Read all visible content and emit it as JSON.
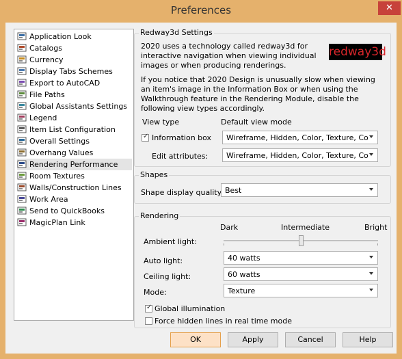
{
  "window": {
    "title": "Preferences",
    "close_glyph": "✕",
    "accent": "#e5b16c"
  },
  "tree": {
    "items": [
      {
        "label": "Application Look",
        "icon": "application-look-icon"
      },
      {
        "label": "Catalogs",
        "icon": "catalogs-icon"
      },
      {
        "label": "Currency",
        "icon": "currency-icon"
      },
      {
        "label": "Display Tabs Schemes",
        "icon": "display-tabs-icon"
      },
      {
        "label": "Export to AutoCAD",
        "icon": "export-autocad-icon"
      },
      {
        "label": "File Paths",
        "icon": "file-paths-icon"
      },
      {
        "label": "Global Assistants Settings",
        "icon": "global-assistants-icon"
      },
      {
        "label": "Legend",
        "icon": "legend-icon"
      },
      {
        "label": "Item List Configuration",
        "icon": "item-list-icon"
      },
      {
        "label": "Overall Settings",
        "icon": "overall-settings-icon"
      },
      {
        "label": "Overhang Values",
        "icon": "overhang-values-icon"
      },
      {
        "label": "Rendering Performance",
        "icon": "rendering-performance-icon",
        "selected": true
      },
      {
        "label": "Room Textures",
        "icon": "room-textures-icon"
      },
      {
        "label": "Walls/Construction Lines",
        "icon": "walls-icon"
      },
      {
        "label": "Work Area",
        "icon": "work-area-icon"
      },
      {
        "label": "Send to QuickBooks",
        "icon": "quickbooks-icon"
      },
      {
        "label": "MagicPlan Link",
        "icon": "magicplan-icon"
      }
    ]
  },
  "redway": {
    "legend": "Redway3d Settings",
    "intro": "2020 uses a technology called redway3d for interactive navigation when viewing individual images or when producing renderings.",
    "logo_red": "red",
    "logo_rest": "way3d",
    "notice": "If you notice that 2020 Design is unusually slow when viewing an item's image in the Information Box or when using the Walkthrough feature in the Rendering Module, disable the following view types accordingly.",
    "col_view_type": "View type",
    "col_default_mode": "Default view mode",
    "info_box_label": "Information box",
    "info_box_checked": true,
    "info_box_value": "Wireframe, Hidden, Color, Texture, Color ...",
    "edit_attr_label": "Edit attributes:",
    "edit_attr_value": "Wireframe, Hidden, Color, Texture, Color ..."
  },
  "shapes": {
    "legend": "Shapes",
    "quality_label": "Shape display quality:",
    "quality_value": "Best"
  },
  "rendering": {
    "legend": "Rendering",
    "slider_low": "Dark",
    "slider_mid": "Intermediate",
    "slider_high": "Bright",
    "ambient_label": "Ambient light:",
    "ambient_level": 0.5,
    "auto_label": "Auto light:",
    "auto_value": "40 watts",
    "ceiling_label": "Ceiling light:",
    "ceiling_value": "60 watts",
    "mode_label": "Mode:",
    "mode_value": "Texture",
    "global_illum_label": "Global illumination",
    "global_illum_checked": true,
    "force_hidden_label": "Force hidden lines in real time mode",
    "force_hidden_checked": false
  },
  "buttons": {
    "ok": "OK",
    "apply": "Apply",
    "cancel": "Cancel",
    "help": "Help"
  }
}
